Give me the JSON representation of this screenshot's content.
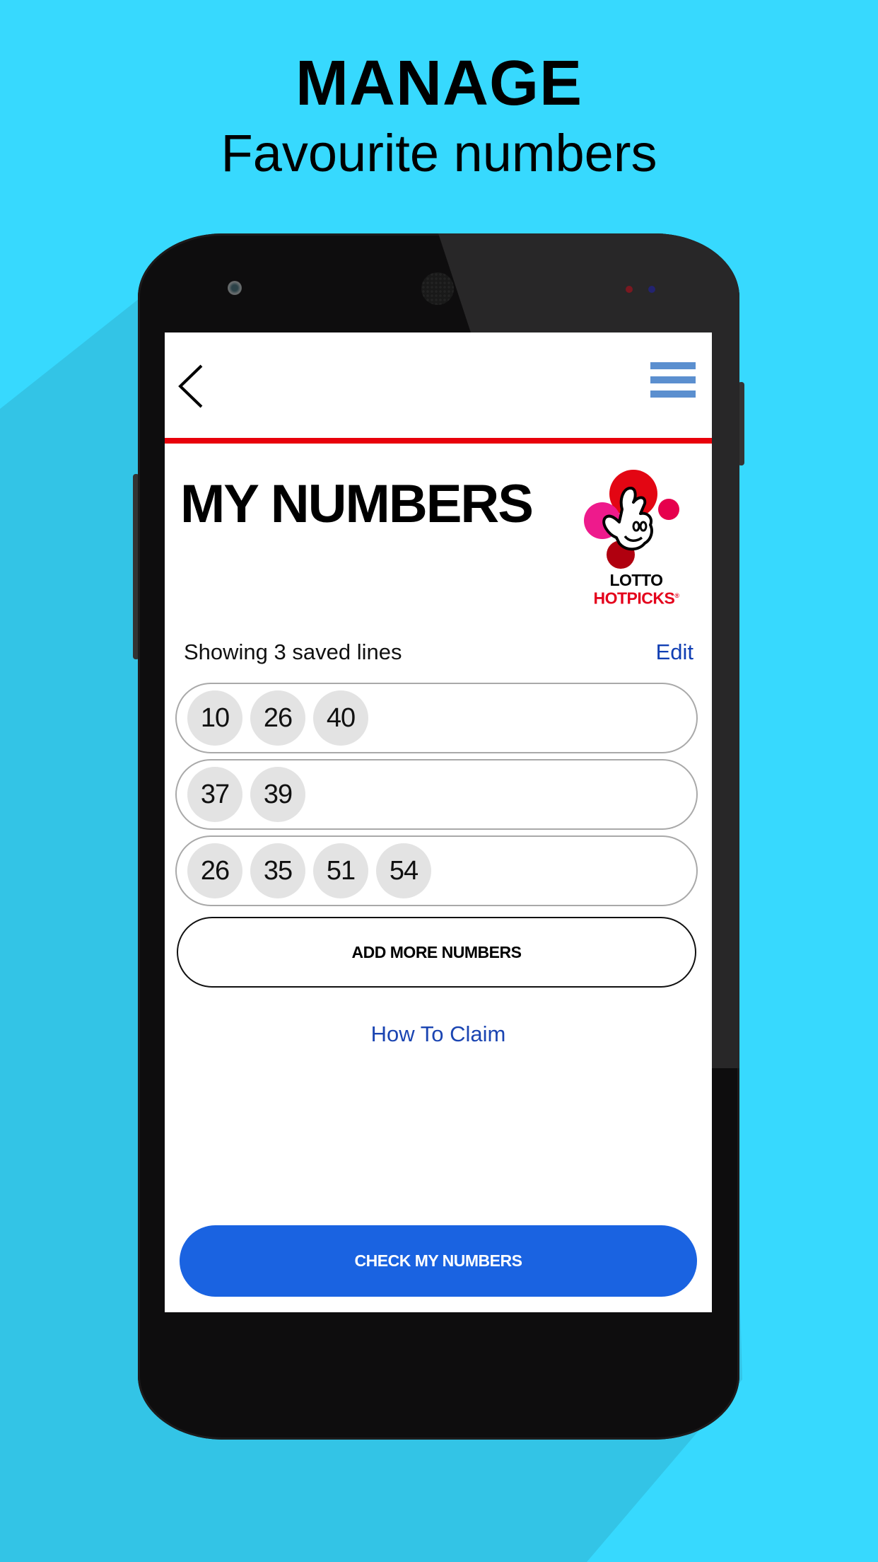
{
  "promo": {
    "title": "MANAGE",
    "subtitle": "Favourite numbers"
  },
  "colors": {
    "background": "#37d9fe",
    "background_shadow": "#33c4e6",
    "phone_body": "#0e0d0e",
    "header_rule": "#e8000b",
    "menu_icon": "#5b8fcf",
    "link": "#113fb3",
    "primary_button": "#1a63e1",
    "ball": "#e3e3e3"
  },
  "header": {
    "back_icon": "chevron-left-icon",
    "menu_icon": "hamburger-menu-icon"
  },
  "page": {
    "title": "MY NUMBERS",
    "logo": {
      "line1": "LOTTO",
      "line2": "HOTPICKS",
      "registered_mark": "®"
    },
    "saved_label": "Showing 3 saved lines",
    "edit_label": "Edit",
    "lines": [
      {
        "numbers": [
          "10",
          "26",
          "40"
        ]
      },
      {
        "numbers": [
          "37",
          "39"
        ]
      },
      {
        "numbers": [
          "26",
          "35",
          "51",
          "54"
        ]
      }
    ],
    "add_more_label": "ADD MORE NUMBERS",
    "how_to_claim_label": "How To Claim",
    "check_label": "CHECK MY NUMBERS"
  }
}
